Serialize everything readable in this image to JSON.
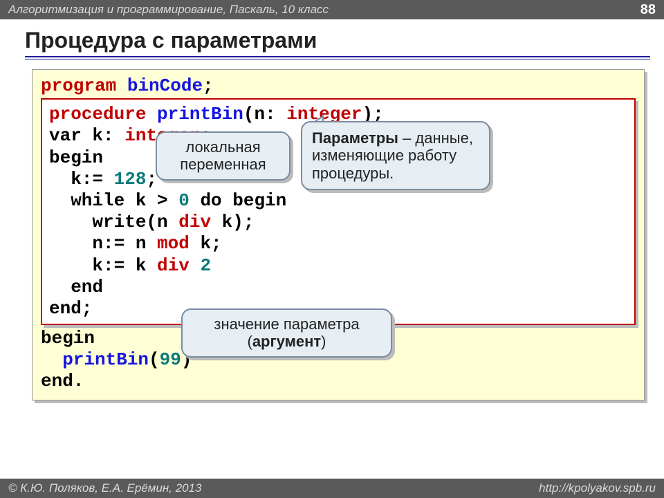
{
  "header": {
    "course": "Алгоритмизация и программирование, Паскаль, 10 класс",
    "page_number": "88"
  },
  "title": "Процедура с параметрами",
  "code": {
    "program_kw": "program",
    "program_name": "binCode",
    "semicolon": ";",
    "procedure_kw": "procedure",
    "proc_name": "printBin",
    "param_open": "(n: ",
    "int_kw": "integer",
    "param_close": ");",
    "var_line_a": "var k: ",
    "var_line_b": "integer",
    "begin_kw": "begin",
    "assign_k": "  k:= ",
    "val_128": "128",
    "semi": ";",
    "while_a": "  while k > ",
    "zero": "0",
    "while_b": " do begin",
    "write_a": "    write(n ",
    "div_kw": "div",
    "write_b": " k);",
    "mod_a": "    n:= n ",
    "mod_kw": "mod",
    "mod_b": " k;",
    "div2_a": "    k:= k ",
    "div2_b": " ",
    "two": "2",
    "end_kw": "  end",
    "end_proc": "end;",
    "main_begin": "begin",
    "call_a": "  ",
    "call_name": "printBin",
    "call_open": "(",
    "arg_99": "99",
    "call_close": ")",
    "main_end": "end."
  },
  "callouts": {
    "local_l1": "локальная",
    "local_l2": "переменная",
    "param_bold": "Параметры",
    "param_rest": " – данные, изменяющие работу процедуры.",
    "arg_l1": "значение параметра",
    "arg_open": "(",
    "arg_bold": "аргумент",
    "arg_close": ")"
  },
  "footer": {
    "copyright": "© К.Ю. Поляков, Е.А. Ерёмин, 2013",
    "url": "http://kpolyakov.spb.ru"
  }
}
